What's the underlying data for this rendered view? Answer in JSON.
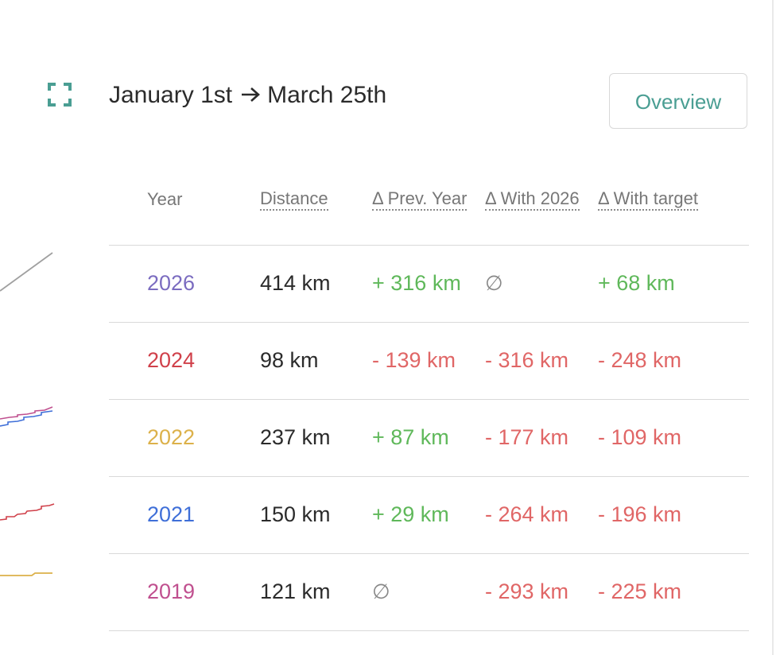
{
  "header": {
    "range_start": "January 1st",
    "range_end": "March 25th",
    "overview_label": "Overview"
  },
  "table": {
    "columns": [
      "Year",
      "Distance",
      "Δ Prev. Year",
      "Δ With 2026",
      "Δ With target"
    ],
    "rows": [
      {
        "year": "2026",
        "distance": "414 km",
        "prev": "+ 316 km",
        "with": "∅",
        "target": "+ 68 km"
      },
      {
        "year": "2024",
        "distance": "98 km",
        "prev": "- 139 km",
        "with": "- 316 km",
        "target": "- 248 km"
      },
      {
        "year": "2022",
        "distance": "237 km",
        "prev": "+ 87 km",
        "with": "- 177 km",
        "target": "- 109 km"
      },
      {
        "year": "2021",
        "distance": "150 km",
        "prev": "+ 29 km",
        "with": "- 264 km",
        "target": "- 196 km"
      },
      {
        "year": "2019",
        "distance": "121 km",
        "prev": "∅",
        "with": "- 293 km",
        "target": "- 225 km"
      }
    ]
  },
  "colors": {
    "accent": "#4a9e93",
    "positive": "#5fb85a",
    "negative": "#e06666",
    "year_2026": "#7b6cc0",
    "year_2024": "#d0404a",
    "year_2022": "#dcb14a",
    "year_2021": "#3f6fd8",
    "year_2019": "#c0508f"
  },
  "icons": {
    "expand": "expand-icon",
    "arrow": "arrow-right-icon"
  }
}
